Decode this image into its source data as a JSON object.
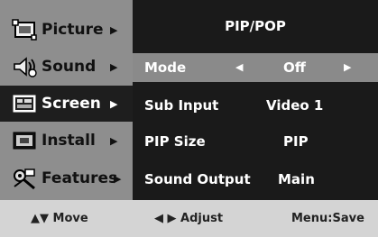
{
  "sidebar": {
    "items": [
      {
        "label": "Picture",
        "arrow": "▶",
        "icon": "picture-icon"
      },
      {
        "label": "Sound",
        "arrow": "▶",
        "icon": "sound-icon"
      },
      {
        "label": "Screen",
        "arrow": "▶",
        "icon": "screen-icon"
      },
      {
        "label": "Install",
        "arrow": "▶",
        "icon": "install-icon"
      },
      {
        "label": "Features",
        "arrow": "▶",
        "icon": "features-icon"
      }
    ],
    "active": "Screen"
  },
  "panel": {
    "title": "PIP/POP",
    "rows": [
      {
        "label": "Mode",
        "value": "Off",
        "left_arrow": "◀",
        "right_arrow": "▶"
      },
      {
        "label": "Sub Input",
        "value": "Video 1"
      },
      {
        "label": "PIP Size",
        "value": "PIP"
      },
      {
        "label": "Sound Output",
        "value": "Main"
      }
    ]
  },
  "footer": {
    "move": "▲▼ Move",
    "adjust": "◀ ▶ Adjust",
    "save": "Menu:Save"
  },
  "colors": {
    "sidebar_bg": "#8e8e8e",
    "panel_bg": "#1a1a1a",
    "selected_row_bg": "#8a8a8a",
    "active_item_bg": "#1e1e1e",
    "footer_bg": "#d4d4d4"
  }
}
